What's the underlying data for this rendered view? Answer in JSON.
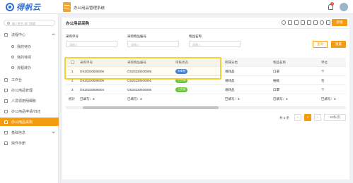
{
  "header": {
    "logo_text": "得帆云",
    "system_title": "办公用品管理系统",
    "notification_count": "1"
  },
  "sidebar": {
    "search_placeholder": "输入姓名·部门搜索",
    "items": [
      {
        "label": "流程中心",
        "type": "group",
        "expanded": true
      },
      {
        "label": "我的待办",
        "type": "sub"
      },
      {
        "label": "我的待阅",
        "type": "sub"
      },
      {
        "label": "流程转办",
        "type": "sub"
      },
      {
        "label": "工作台",
        "type": "item"
      },
      {
        "label": "办公用品管理",
        "type": "item"
      },
      {
        "label": "人员领用明细账",
        "type": "item"
      },
      {
        "label": "办公用品申请/归还",
        "type": "item"
      },
      {
        "label": "办公用品采购",
        "type": "item",
        "active": true
      },
      {
        "label": "基础信息",
        "type": "group"
      },
      {
        "label": "操作手册",
        "type": "item"
      }
    ]
  },
  "panel": {
    "title": "办公用品采购",
    "add_button": "新增",
    "filters": [
      {
        "label": "采购单号",
        "placeholder": "请输入"
      },
      {
        "label": "采购物品编号",
        "placeholder": "请输入"
      },
      {
        "label": "物品名称",
        "placeholder": "请输入"
      }
    ],
    "query_button": "查询",
    "reset_button": "重置"
  },
  "table": {
    "columns": [
      "采购单号",
      "采购物品编号",
      "审核状态",
      "所属分类",
      "物品名称",
      "单位"
    ],
    "rows": [
      {
        "index": "1",
        "order_no": "OS20230506006",
        "item_no": "OS20230400005",
        "status": "未审核",
        "status_color": "#3a7bd5",
        "category": "易耗品",
        "name": "口罩",
        "unit": "个"
      },
      {
        "index": "2",
        "order_no": "OS20230506005",
        "item_no": "OS20230400001",
        "status": "已完成",
        "status_color": "#67c23a",
        "category": "易耗品",
        "name": "抽纸",
        "unit": "包"
      },
      {
        "index": "3",
        "order_no": "OS20230506004",
        "item_no": "OS20230400005",
        "status": "已完成",
        "status_color": "#67c23a",
        "category": "易耗品",
        "name": "口罩",
        "unit": "个"
      }
    ],
    "footer": {
      "label": "统计",
      "fill": "已填写：3"
    }
  },
  "pagination": {
    "total": "共 3 条",
    "current_page": "1",
    "page_size": "10条/页"
  },
  "colors": {
    "accent": "#f39c12",
    "highlight": "#f2d230",
    "brand": "#2f6fd6"
  }
}
